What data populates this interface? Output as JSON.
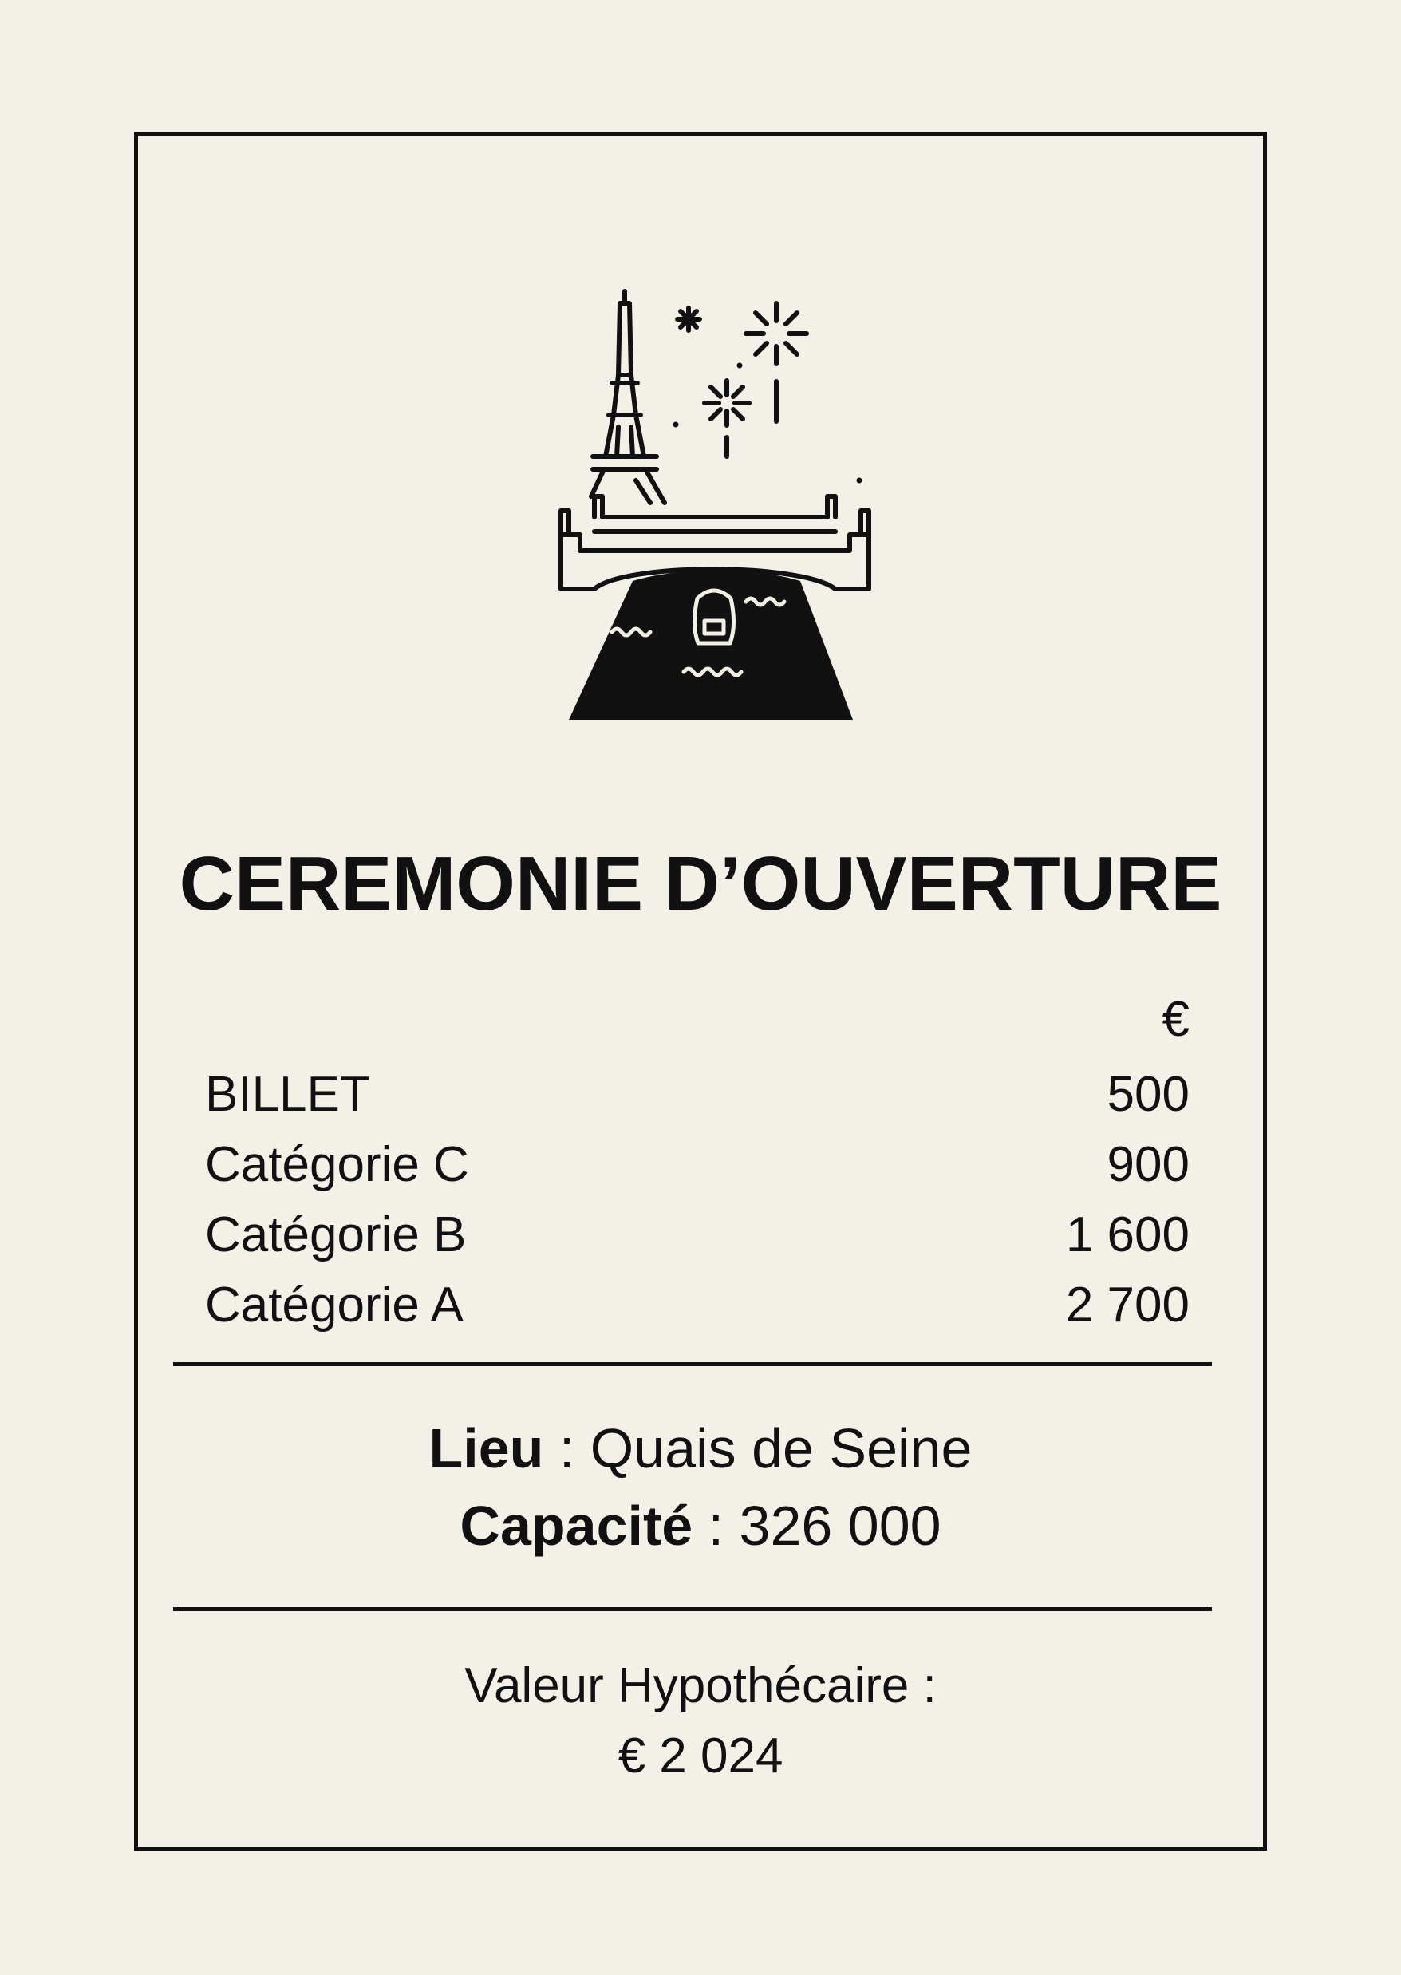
{
  "card": {
    "title": "CEREMONIE D’OUVERTURE",
    "illustration_icon": "eiffel-tower-bridge-fireworks-icon",
    "currency_symbol": "€",
    "prices": [
      {
        "label": "BILLET",
        "value": "500"
      },
      {
        "label": "Catégorie C",
        "value": "900"
      },
      {
        "label": "Catégorie B",
        "value": "1 600"
      },
      {
        "label": "Catégorie A",
        "value": "2 700"
      }
    ],
    "venue": {
      "label": "Lieu",
      "separator": " : ",
      "value": "Quais de Seine"
    },
    "capacity": {
      "label": "Capacité",
      "separator": " : ",
      "value": "326 000"
    },
    "mortgage": {
      "label": "Valeur Hypothécaire :",
      "value": "€ 2 024"
    }
  }
}
